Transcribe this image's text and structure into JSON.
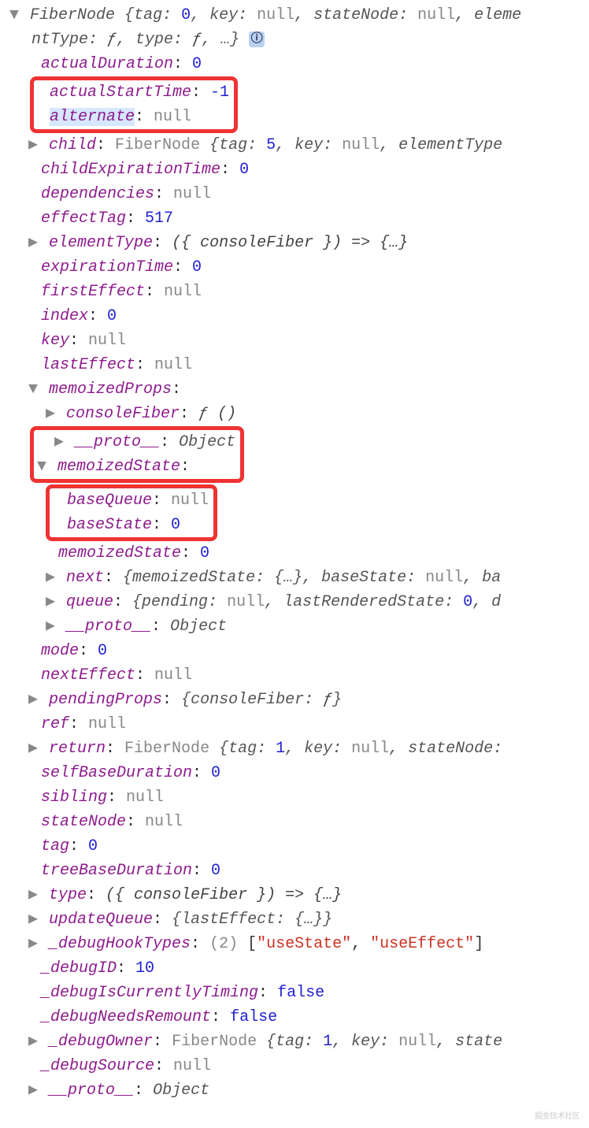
{
  "header": {
    "type_name": "FiberNode",
    "summary_props": "{tag: 0, key: null, stateNode: null, elementType: ƒ, type: ƒ, …}",
    "info_badge": "ⓘ"
  },
  "props": {
    "actualDuration": {
      "label": "actualDuration",
      "value": "0",
      "kind": "num"
    },
    "actualStartTime": {
      "label": "actualStartTime",
      "value": "-1",
      "kind": "num"
    },
    "alternate": {
      "label": "alternate",
      "value": "null",
      "kind": "null"
    },
    "child": {
      "label": "child",
      "type": "FiberNode",
      "summary": "{tag: 5, key: null, elementType"
    },
    "childExpirationTime": {
      "label": "childExpirationTime",
      "value": "0",
      "kind": "num"
    },
    "dependencies": {
      "label": "dependencies",
      "value": "null",
      "kind": "null"
    },
    "effectTag": {
      "label": "effectTag",
      "value": "517",
      "kind": "num"
    },
    "elementType": {
      "label": "elementType",
      "summary": "({ consoleFiber }) => {…}"
    },
    "expirationTime": {
      "label": "expirationTime",
      "value": "0",
      "kind": "num"
    },
    "firstEffect": {
      "label": "firstEffect",
      "value": "null",
      "kind": "null"
    },
    "index": {
      "label": "index",
      "value": "0",
      "kind": "num"
    },
    "key": {
      "label": "key",
      "value": "null",
      "kind": "null"
    },
    "lastEffect": {
      "label": "lastEffect",
      "value": "null",
      "kind": "null"
    },
    "memoizedProps": {
      "label": "memoizedProps"
    },
    "memoizedProps_consoleFiber": {
      "label": "consoleFiber",
      "summary": "ƒ ()"
    },
    "memoizedProps_proto": {
      "label": "__proto__",
      "value": "Object"
    },
    "memoizedState": {
      "label": "memoizedState"
    },
    "memoizedState_baseQueue": {
      "label": "baseQueue",
      "value": "null",
      "kind": "null"
    },
    "memoizedState_baseState": {
      "label": "baseState",
      "value": "0",
      "kind": "num"
    },
    "memoizedState_memoizedState": {
      "label": "memoizedState",
      "value": "0",
      "kind": "num"
    },
    "memoizedState_next": {
      "label": "next",
      "summary": "{memoizedState: {…}, baseState: null, ba"
    },
    "memoizedState_queue": {
      "label": "queue",
      "summary": "{pending: null, lastRenderedState: 0, d"
    },
    "memoizedState_proto": {
      "label": "__proto__",
      "value": "Object"
    },
    "mode": {
      "label": "mode",
      "value": "0",
      "kind": "num"
    },
    "nextEffect": {
      "label": "nextEffect",
      "value": "null",
      "kind": "null"
    },
    "pendingProps": {
      "label": "pendingProps",
      "summary": "{consoleFiber: ƒ}"
    },
    "ref": {
      "label": "ref",
      "value": "null",
      "kind": "null"
    },
    "return": {
      "label": "return",
      "type": "FiberNode",
      "summary": "{tag: 1, key: null, stateNode:"
    },
    "selfBaseDuration": {
      "label": "selfBaseDuration",
      "value": "0",
      "kind": "num"
    },
    "sibling": {
      "label": "sibling",
      "value": "null",
      "kind": "null"
    },
    "stateNode": {
      "label": "stateNode",
      "value": "null",
      "kind": "null"
    },
    "tag": {
      "label": "tag",
      "value": "0",
      "kind": "num"
    },
    "treeBaseDuration": {
      "label": "treeBaseDuration",
      "value": "0",
      "kind": "num"
    },
    "type": {
      "label": "type",
      "summary": "({ consoleFiber }) => {…}"
    },
    "updateQueue": {
      "label": "updateQueue",
      "summary": "{lastEffect: {…}}"
    },
    "debugHookTypes": {
      "label": "_debugHookTypes",
      "count": "(2)",
      "items": "[\"useState\", \"useEffect\"]"
    },
    "debugID": {
      "label": "_debugID",
      "value": "10",
      "kind": "num"
    },
    "debugIsCurrentlyTiming": {
      "label": "_debugIsCurrentlyTiming",
      "value": "false",
      "kind": "num"
    },
    "debugNeedsRemount": {
      "label": "_debugNeedsRemount",
      "value": "false",
      "kind": "num"
    },
    "debugOwner": {
      "label": "_debugOwner",
      "type": "FiberNode",
      "summary": "{tag: 1, key: null, state"
    },
    "debugSource": {
      "label": "_debugSource",
      "value": "null",
      "kind": "null"
    },
    "proto": {
      "label": "__proto__",
      "value": "Object"
    }
  },
  "glyphs": {
    "right": "▶",
    "down": "▼"
  },
  "watermark": "掘金技术社区"
}
